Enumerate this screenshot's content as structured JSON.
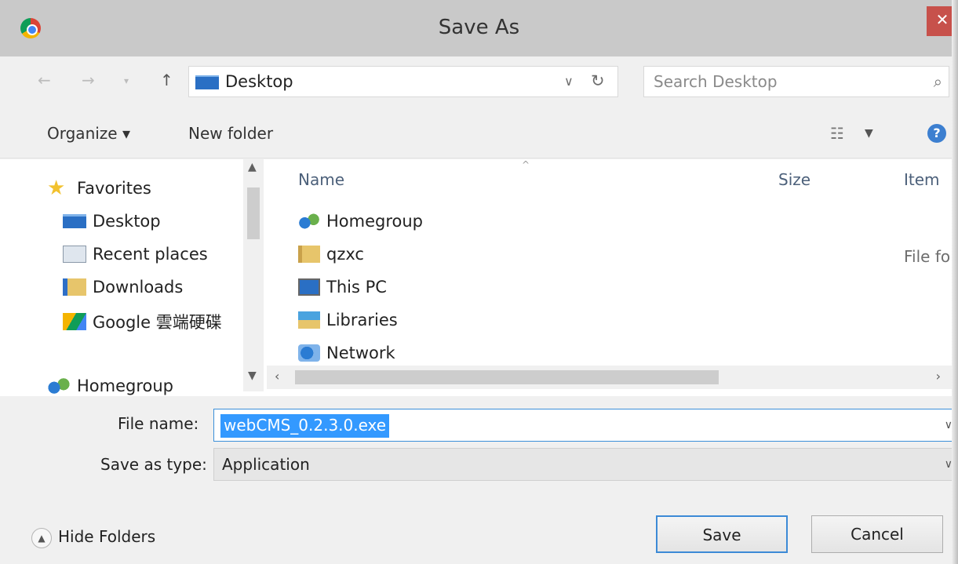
{
  "window": {
    "title": "Save As",
    "close_label": "✕"
  },
  "address": {
    "path": "Desktop",
    "search_placeholder": "Search Desktop"
  },
  "toolbar": {
    "organize_label": "Organize ▾",
    "new_folder_label": "New folder"
  },
  "nav_pane": {
    "items": [
      {
        "label": "Favorites",
        "icon": "star-icon"
      },
      {
        "label": "Desktop",
        "icon": "desktop-icon"
      },
      {
        "label": "Recent places",
        "icon": "recent-places-icon"
      },
      {
        "label": "Downloads",
        "icon": "downloads-folder-icon"
      },
      {
        "label": "Google 雲端硬碟",
        "icon": "google-drive-icon"
      },
      {
        "label": "Homegroup",
        "icon": "homegroup-icon"
      }
    ]
  },
  "file_list": {
    "columns": [
      "Name",
      "Size",
      "Item"
    ],
    "rows": [
      {
        "name": "Homegroup",
        "type": "",
        "icon": "homegroup-icon"
      },
      {
        "name": "qzxc",
        "type": "File fo",
        "icon": "folder-icon"
      },
      {
        "name": "This PC",
        "type": "",
        "icon": "computer-icon"
      },
      {
        "name": "Libraries",
        "type": "",
        "icon": "libraries-icon"
      },
      {
        "name": "Network",
        "type": "",
        "icon": "network-icon"
      }
    ]
  },
  "form": {
    "file_name_label": "File name:",
    "file_name_value": "webCMS_0.2.3.0.exe",
    "save_type_label": "Save as type:",
    "save_type_value": "Application"
  },
  "buttons": {
    "hide_folders": "Hide Folders",
    "save": "Save",
    "cancel": "Cancel"
  },
  "colors": {
    "selection": "#3399ff",
    "close_button": "#c7514b",
    "focus_border": "#3c8ad6"
  }
}
